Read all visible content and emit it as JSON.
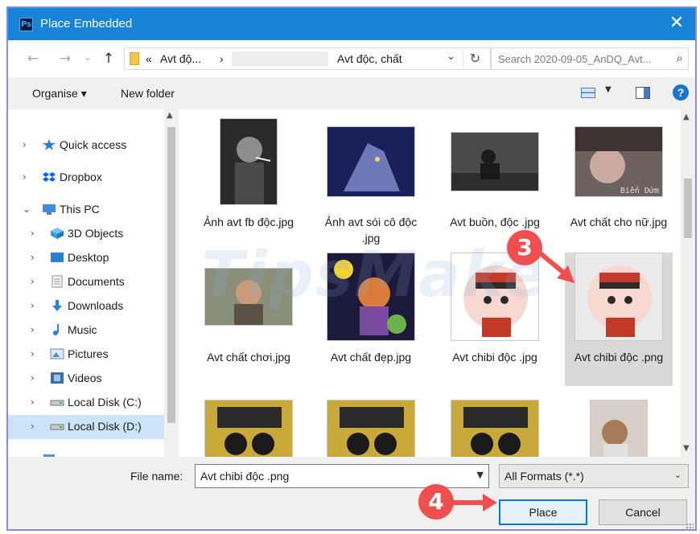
{
  "window": {
    "title": "Place Embedded",
    "app_icon_text": "Ps",
    "close_glyph": "✕"
  },
  "address_bar": {
    "back_glyph": "←",
    "forward_glyph": "→",
    "up_glyph": "↑",
    "prefix_glyph": "«",
    "crumb_1": "Avt độ...",
    "separator": "›",
    "current": "Avt độc, chất",
    "dropdown_glyph": "⌄",
    "refresh_glyph": "↻",
    "search_placeholder": "Search 2020-09-05_AnDQ_Avt...",
    "search_glyph": "⌕"
  },
  "toolbar": {
    "organise_label": "Organise ▾",
    "new_folder_label": "New folder",
    "help_label": "?"
  },
  "nav_pane": {
    "items": [
      {
        "label": "Quick access",
        "chevron": "›",
        "icon": "star-icon"
      },
      {
        "label": "Dropbox",
        "chevron": "›",
        "icon": "dropbox-icon"
      },
      {
        "label": "This PC",
        "chevron": "⌄",
        "icon": "pc-icon"
      },
      {
        "label": "3D Objects",
        "chevron": "›",
        "icon": "cube-icon"
      },
      {
        "label": "Desktop",
        "chevron": "›",
        "icon": "desktop-icon"
      },
      {
        "label": "Documents",
        "chevron": "›",
        "icon": "documents-icon"
      },
      {
        "label": "Downloads",
        "chevron": "›",
        "icon": "download-icon"
      },
      {
        "label": "Music",
        "chevron": "›",
        "icon": "music-icon"
      },
      {
        "label": "Pictures",
        "chevron": "›",
        "icon": "pictures-icon"
      },
      {
        "label": "Videos",
        "chevron": "›",
        "icon": "videos-icon"
      },
      {
        "label": "Local Disk (C:)",
        "chevron": "›",
        "icon": "disk-icon"
      },
      {
        "label": "Local Disk (D:)",
        "chevron": "›",
        "icon": "disk-icon",
        "selected": true
      }
    ]
  },
  "files": [
    {
      "name": "Ảnh avt fb độc.jpg"
    },
    {
      "name": "Ảnh avt sói cô độc .jpg"
    },
    {
      "name": "Avt buồn, độc .jpg"
    },
    {
      "name": "Avt chất cho nữ.jpg",
      "thumb_caption": "Biển Dứm"
    },
    {
      "name": "Avt chất chơi.jpg"
    },
    {
      "name": "Avt chất đẹp.jpg"
    },
    {
      "name": "Avt chibi độc .jpg"
    },
    {
      "name": "Avt chibi độc .png",
      "selected": true
    },
    {
      "name": ""
    },
    {
      "name": ""
    },
    {
      "name": ""
    },
    {
      "name": ""
    }
  ],
  "bottom": {
    "file_name_label": "File name:",
    "file_name_value": "Avt chibi độc .png",
    "format_value": "All Formats (*.*)",
    "place_label": "Place",
    "cancel_label": "Cancel"
  },
  "annotations": {
    "step_3": "3",
    "step_4": "4",
    "watermark": "TipsMake",
    "accent_color": "#ef4f4f"
  }
}
